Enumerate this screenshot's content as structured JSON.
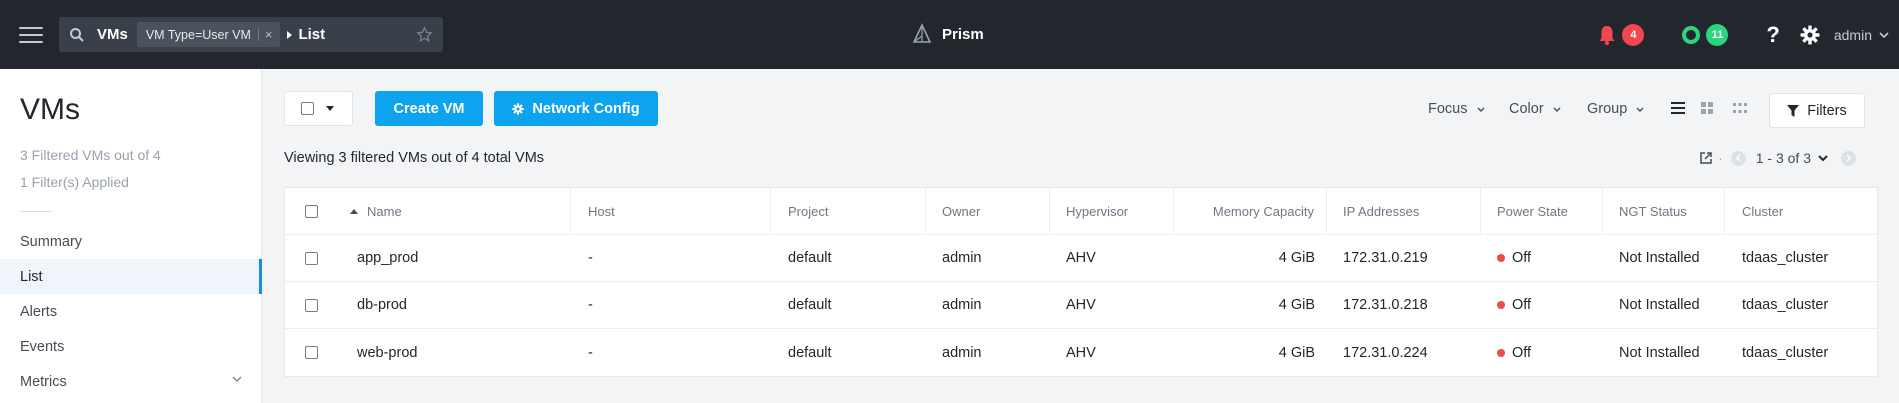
{
  "topbar": {
    "search_root": "VMs",
    "filter_chip": "VM Type=User VM",
    "chip_close": "×",
    "crumb_leaf": "List",
    "brand": "Prism",
    "alerts_count": "4",
    "tasks_count": "11",
    "help": "?",
    "user": "admin"
  },
  "sidebar": {
    "title": "VMs",
    "filtered_text": "3 Filtered VMs out of 4",
    "filters_applied": "1 Filter(s) Applied",
    "items": [
      {
        "label": "Summary"
      },
      {
        "label": "List"
      },
      {
        "label": "Alerts"
      },
      {
        "label": "Events"
      },
      {
        "label": "Metrics"
      }
    ]
  },
  "toolbar": {
    "create_vm": "Create VM",
    "network_config": "Network Config",
    "focus": "Focus",
    "color": "Color",
    "group": "Group",
    "filters": "Filters"
  },
  "viewing_text": "Viewing 3 filtered VMs out of 4 total VMs",
  "pager": {
    "range": "1 - 3 of 3"
  },
  "table": {
    "columns": [
      "Name",
      "Host",
      "Project",
      "Owner",
      "Hypervisor",
      "Memory Capacity",
      "IP Addresses",
      "Power State",
      "NGT Status",
      "Cluster"
    ],
    "rows": [
      {
        "name": "app_prod",
        "host": "-",
        "project": "default",
        "owner": "admin",
        "hypervisor": "AHV",
        "memory": "4 GiB",
        "ip": "172.31.0.219",
        "power": "Off",
        "ngt": "Not Installed",
        "cluster": "tdaas_cluster"
      },
      {
        "name": "db-prod",
        "host": "-",
        "project": "default",
        "owner": "admin",
        "hypervisor": "AHV",
        "memory": "4 GiB",
        "ip": "172.31.0.218",
        "power": "Off",
        "ngt": "Not Installed",
        "cluster": "tdaas_cluster"
      },
      {
        "name": "web-prod",
        "host": "-",
        "project": "default",
        "owner": "admin",
        "hypervisor": "AHV",
        "memory": "4 GiB",
        "ip": "172.31.0.224",
        "power": "Off",
        "ngt": "Not Installed",
        "cluster": "tdaas_cluster"
      }
    ]
  },
  "colors": {
    "topbar": "#22272e",
    "primary": "#0ea3ee",
    "alert": "#f0484c",
    "success": "#2bd47d",
    "active_nav": "#1a8fe0"
  }
}
